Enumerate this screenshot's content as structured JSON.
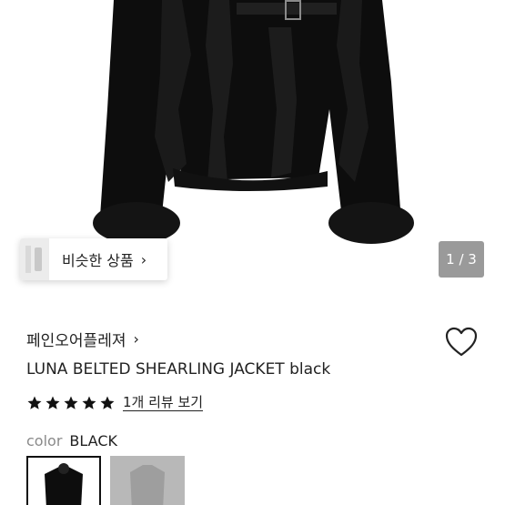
{
  "similar": {
    "label": "비슷한 상품",
    "chevron": "›"
  },
  "gallery": {
    "indicator": "1 / 3",
    "current": 1,
    "total": 3
  },
  "product": {
    "brand": "페인오어플레져",
    "brand_chevron": "›",
    "title": "LUNA BELTED SHEARLING JACKET black",
    "rating_stars": 5,
    "review_link": "1개 리뷰 보기"
  },
  "options": {
    "color_key": "color",
    "color_value": "BLACK",
    "swatches": [
      {
        "name": "black",
        "selected": true
      },
      {
        "name": "gray",
        "selected": false
      }
    ]
  },
  "colors": {
    "star": "#111111",
    "indicator_bg": "#9a9a9a"
  }
}
